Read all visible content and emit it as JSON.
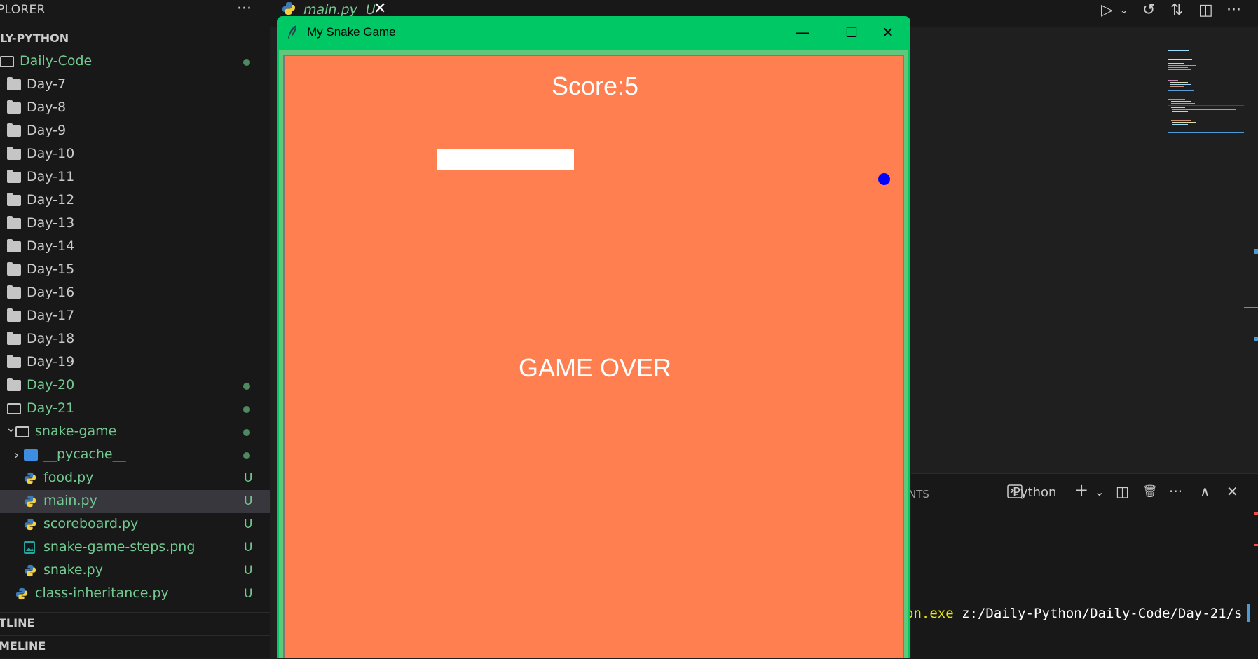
{
  "explorer": {
    "title": "PLORER",
    "more": "···",
    "root": "ILY-PYTHON",
    "items": [
      {
        "label": "Daily-Code",
        "type": "folder-open",
        "indent": 0,
        "status": "dot"
      },
      {
        "label": "Day-7",
        "type": "folder",
        "indent": 1
      },
      {
        "label": "Day-8",
        "type": "folder",
        "indent": 1
      },
      {
        "label": "Day-9",
        "type": "folder",
        "indent": 1
      },
      {
        "label": "Day-10",
        "type": "folder",
        "indent": 1
      },
      {
        "label": "Day-11",
        "type": "folder",
        "indent": 1
      },
      {
        "label": "Day-12",
        "type": "folder",
        "indent": 1
      },
      {
        "label": "Day-13",
        "type": "folder",
        "indent": 1
      },
      {
        "label": "Day-14",
        "type": "folder",
        "indent": 1
      },
      {
        "label": "Day-15",
        "type": "folder",
        "indent": 1
      },
      {
        "label": "Day-16",
        "type": "folder",
        "indent": 1
      },
      {
        "label": "Day-17",
        "type": "folder",
        "indent": 1
      },
      {
        "label": "Day-18",
        "type": "folder",
        "indent": 1
      },
      {
        "label": "Day-19",
        "type": "folder",
        "indent": 1
      },
      {
        "label": "Day-20",
        "type": "folder",
        "indent": 1,
        "status": "dot"
      },
      {
        "label": "Day-21",
        "type": "folder-open",
        "indent": 1,
        "status": "dot"
      },
      {
        "label": "snake-game",
        "type": "folder-open",
        "indent": 2,
        "status": "dot",
        "chevron": "down"
      },
      {
        "label": "__pycache__",
        "type": "folder-blue",
        "indent": 3,
        "status": "dot",
        "chevron": "right"
      },
      {
        "label": "food.py",
        "type": "python",
        "indent": 3,
        "status": "U"
      },
      {
        "label": "main.py",
        "type": "python",
        "indent": 3,
        "status": "U",
        "selected": true
      },
      {
        "label": "scoreboard.py",
        "type": "python",
        "indent": 3,
        "status": "U"
      },
      {
        "label": "snake-game-steps.png",
        "type": "image",
        "indent": 3,
        "status": "U"
      },
      {
        "label": "snake.py",
        "type": "python",
        "indent": 3,
        "status": "U"
      },
      {
        "label": "class-inheritance.py",
        "type": "python",
        "indent": 2,
        "status": "U"
      }
    ],
    "outline": "TLINE",
    "timeline": "MELINE"
  },
  "tab": {
    "label": "main.py",
    "badge": "U",
    "close": "✕"
  },
  "toolbar": {
    "run": "▷",
    "run_menu": "⌄",
    "timeline": "↺",
    "compare": "⇅",
    "split": "◫",
    "more": "···"
  },
  "panel": {
    "tab_partial": "NTS",
    "terminal_label": "Python",
    "add": "+",
    "add_menu": "⌄",
    "split": "◫",
    "trash": "🗑",
    "more": "···",
    "maximize": "∧",
    "close": "✕",
    "line_yellow": "on.exe",
    "line_rest": " z:/Daily-Python/Daily-Code/Day-21/s"
  },
  "game_window": {
    "title": "My Snake Game",
    "minimize": "—",
    "maximize": "☐",
    "close": "✕",
    "score_text": "Score:5",
    "game_over_text": "GAME OVER",
    "snake_segments": 3,
    "colors": {
      "titlebar": "#00c864",
      "canvas_bg": "#ff7f50",
      "snake": "#ffffff",
      "food": "#0000ff",
      "text": "#ffffff"
    }
  }
}
